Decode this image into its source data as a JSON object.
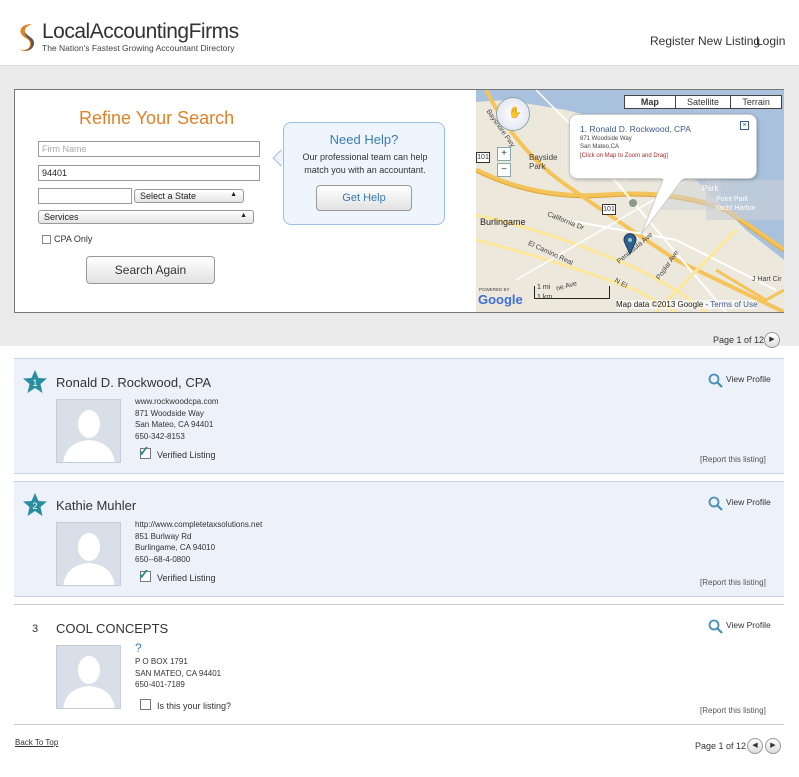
{
  "header": {
    "brand": "LocalAccountingFirms",
    "tagline": "The Nation's Fastest Growing Accountant Directory",
    "nav": {
      "register": "Register New Listing",
      "login": "Login"
    }
  },
  "search": {
    "title": "Refine Your Search",
    "firm_placeholder": "Firm Name",
    "zip_value": "94401",
    "city_value": "",
    "state_label": "Select a State",
    "services_label": "Services",
    "cpa_only_label": "CPA Only",
    "search_again_label": "Search Again"
  },
  "help": {
    "title": "Need Help?",
    "text": "Our professional team can help match you with an accountant.",
    "button": "Get Help"
  },
  "map": {
    "types": [
      "Map",
      "Satellite",
      "Terrain"
    ],
    "selected_type": "Map",
    "popup_title": "1. Ronald D. Rockwood, CPA",
    "popup_address": "871 Woodside Way",
    "popup_city": "San Mateo,CA",
    "popup_hint": "[Click on Map to Zoom and Drag]",
    "labels": {
      "bayside_park": "Bayside\nPark",
      "burlingame": "Burlingame",
      "california_dr": "California Dr",
      "el_camino": "El Camino Real",
      "park": "Park",
      "poplar": "Poplar Ave",
      "peninsula": "Peninsula Ave",
      "n_el": "N El",
      "ne_ave": "ne Ave",
      "j_hart": "J Hart Cir",
      "bayshore": "Bayshore Fwy",
      "highway_101a": "101",
      "highway_101b": "101",
      "scale_mi": "1 mi",
      "scale_km": "1 km",
      "powered_by": "POWERED BY",
      "google": "Google",
      "attribution": "Map data ©2013 Google - ",
      "terms": "Terms of Use",
      "park_right": "Park",
      "point_park": "Point Park",
      "yacht_harbor": "Yacht Harbor"
    }
  },
  "pager": {
    "top": "Page 1 of 12",
    "bottom": "Page 1 of 12",
    "next": "▶",
    "prev": "◀"
  },
  "listings": [
    {
      "rank": "1",
      "name": "Ronald D. Rockwood, CPA",
      "website": "www.rockwoodcpa.com",
      "address": "871 Woodside Way",
      "city": "San Mateo, CA 94401",
      "phone": "650-342-8153",
      "verify_label": "Verified Listing",
      "view_profile": "View Profile",
      "report": "[Report this listing]"
    },
    {
      "rank": "2",
      "name": "Kathie Muhler",
      "website": "http://www.completetaxsolutions.net",
      "address": "851 Burlway Rd",
      "city": "Burlingame, CA 94010",
      "phone": "650--68-4-0800",
      "verify_label": "Verified Listing",
      "view_profile": "View Profile",
      "report": "[Report this listing]"
    },
    {
      "rank": "3",
      "name": "COOL CONCEPTS",
      "website": "?",
      "address": "P O BOX 1791",
      "city": "SAN MATEO, CA 94401",
      "phone": "650-401-7189",
      "verify_label": "Is this your listing?",
      "view_profile": "View Profile",
      "report": "[Report this listing]"
    }
  ],
  "footer": {
    "back_to_top": "Back To Top"
  },
  "colors": {
    "accent_orange": "#e0822b",
    "accent_blue": "#3b7bb4",
    "star_teal": "#2d8da0"
  }
}
